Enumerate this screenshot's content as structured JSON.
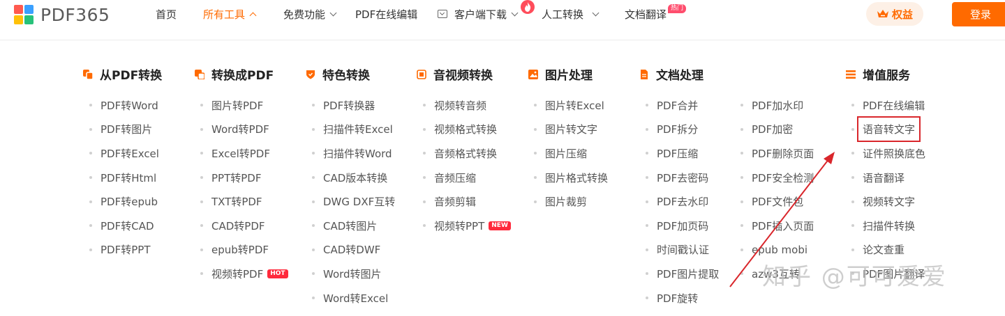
{
  "header": {
    "logo_text": "PDF365",
    "logo_colors": [
      "#ff5a4f",
      "#3aa0ff",
      "#ffc107",
      "#27c27a"
    ],
    "nav": [
      {
        "label": "首页"
      },
      {
        "label": "所有工具",
        "active": true
      },
      {
        "label": "免费功能"
      },
      {
        "label": "PDF在线编辑"
      },
      {
        "label": "客户端下载"
      },
      {
        "label": "人工转换"
      },
      {
        "label": "文档翻译"
      }
    ],
    "hot_tag": "热门",
    "vip_label": "权益",
    "login_label": "登录",
    "accent_color": "#ff6a00"
  },
  "menu": {
    "columns": [
      {
        "title": "从PDF转换",
        "icon": "pdf-from-icon",
        "items": [
          "PDF转Word",
          "PDF转图片",
          "PDF转Excel",
          "PDF转Html",
          "PDF转epub",
          "PDF转CAD",
          "PDF转PPT"
        ]
      },
      {
        "title": "转换成PDF",
        "icon": "pdf-to-icon",
        "items": [
          "图片转PDF",
          "Word转PDF",
          "Excel转PDF",
          "PPT转PDF",
          "TXT转PDF",
          "CAD转PDF",
          "epub转PDF",
          "视频转PDF"
        ],
        "tags": {
          "7": "HOT"
        }
      },
      {
        "title": "特色转换",
        "icon": "shield-icon",
        "items": [
          "PDF转换器",
          "扫描件转Excel",
          "扫描件转Word",
          "CAD版本转换",
          "DWG DXF互转",
          "CAD转图片",
          "CAD转DWF",
          "Word转图片",
          "Word转Excel"
        ]
      },
      {
        "title": "音视频转换",
        "icon": "media-icon",
        "items": [
          "视频转音频",
          "视频格式转换",
          "音频格式转换",
          "音频压缩",
          "音频剪辑",
          "视频转PPT"
        ],
        "tags": {
          "5": "NEW"
        }
      },
      {
        "title": "图片处理",
        "icon": "image-icon",
        "items": [
          "图片转Excel",
          "图片转文字",
          "图片压缩",
          "图片格式转换",
          "图片裁剪"
        ]
      },
      {
        "title": "文档处理",
        "icon": "document-icon",
        "items": [
          "PDF合并",
          "PDF拆分",
          "PDF压缩",
          "PDF去密码",
          "PDF去水印",
          "PDF加页码",
          "时间戳认证",
          "PDF图片提取",
          "PDF旋转"
        ]
      },
      {
        "title": "",
        "icon": "",
        "items": [
          "PDF加水印",
          "PDF加密",
          "PDF删除页面",
          "PDF安全检测",
          "PDF文件包",
          "PDF插入页面",
          "epub mobi",
          "azw3互转"
        ]
      },
      {
        "title": "增值服务",
        "icon": "list-icon",
        "items": [
          "PDF在线编辑",
          "语音转文字",
          "证件照换底色",
          "语音翻译",
          "视频转文字",
          "扫描件转换",
          "论文查重",
          "PDF图片翻译"
        ],
        "highlight_index": 1,
        "highlight_color": "#d9262b"
      }
    ]
  },
  "watermark": "知乎 @可可爱爱"
}
